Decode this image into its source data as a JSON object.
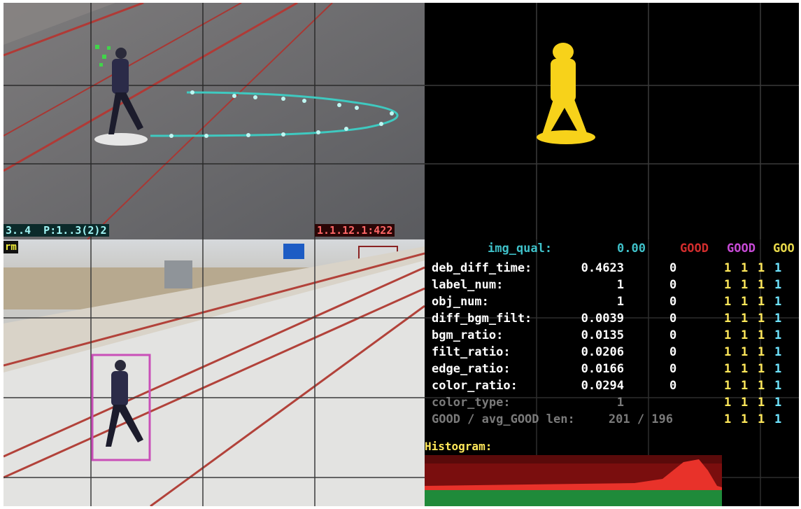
{
  "top_left": {
    "status_left": "3..4  P:1..3(2)2",
    "status_right": "1.1.12.1:422"
  },
  "bottom_left": {
    "alarm_tag": "rm"
  },
  "panel": {
    "header_label": "img_qual:",
    "header_value": "0.00",
    "header_flags": [
      "GOOD",
      "GOOD",
      "GOO"
    ],
    "rows": [
      {
        "name": "deb_diff_time:",
        "value": "0.4623",
        "zero": "0",
        "flags": [
          "1",
          "1",
          "1",
          "1"
        ]
      },
      {
        "name": "label_num:",
        "value": "1",
        "zero": "0",
        "flags": [
          "1",
          "1",
          "1",
          "1"
        ]
      },
      {
        "name": "obj_num:",
        "value": "1",
        "zero": "0",
        "flags": [
          "1",
          "1",
          "1",
          "1"
        ]
      },
      {
        "name": "diff_bgm_filt:",
        "value": "0.0039",
        "zero": "0",
        "flags": [
          "1",
          "1",
          "1",
          "1"
        ]
      },
      {
        "name": "bgm_ratio:",
        "value": "0.0135",
        "zero": "0",
        "flags": [
          "1",
          "1",
          "1",
          "1"
        ]
      },
      {
        "name": "filt_ratio:",
        "value": "0.0206",
        "zero": "0",
        "flags": [
          "1",
          "1",
          "1",
          "1"
        ]
      },
      {
        "name": "edge_ratio:",
        "value": "0.0166",
        "zero": "0",
        "flags": [
          "1",
          "1",
          "1",
          "1"
        ]
      },
      {
        "name": "color_ratio:",
        "value": "0.0294",
        "zero": "0",
        "flags": [
          "1",
          "1",
          "1",
          "1"
        ]
      },
      {
        "name": "color_type:",
        "value": "1",
        "zero": "",
        "flags": [
          "1",
          "1",
          "1",
          "1"
        ],
        "dim": true
      },
      {
        "name": "GOOD / avg_GOOD len:",
        "value": "201 / 196",
        "zero": "",
        "flags": [
          "1",
          "1",
          "1",
          "1"
        ],
        "dim": true
      }
    ],
    "histogram_label": "Histogram:"
  },
  "colors": {
    "track": "#3fc9c0",
    "silhouette": "#f7d21a",
    "bbox": "#c94fb8",
    "good_red": "#d22d2d",
    "good_magenta": "#c74ad6",
    "good_yellow": "#e8d94a",
    "img_qual": "#3fc1c9"
  }
}
